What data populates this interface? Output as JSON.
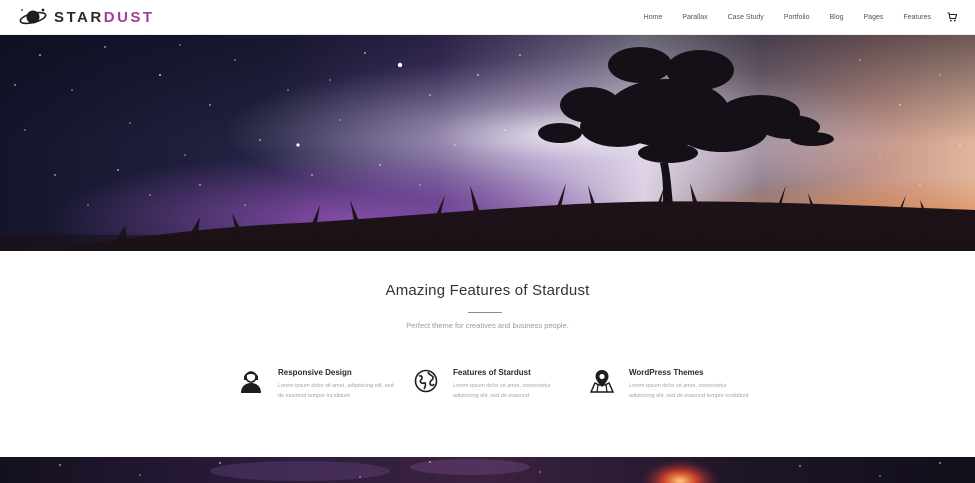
{
  "brand": {
    "name_prefix": "STAR",
    "name_suffix": "DUST",
    "logo_icon": "planet-ring-icon",
    "accent_color": "#a13e96"
  },
  "nav": {
    "items": [
      {
        "label": "Home"
      },
      {
        "label": "Parallax"
      },
      {
        "label": "Case Study"
      },
      {
        "label": "Portfolio"
      },
      {
        "label": "Blog"
      },
      {
        "label": "Pages"
      },
      {
        "label": "Features"
      }
    ],
    "cart_icon": "cart-icon"
  },
  "hero": {
    "image": "starry-night-sky-with-tree-silhouette-and-grass"
  },
  "features_section": {
    "title": "Amazing Features of Stardust",
    "subtitle": "Perfect theme for creatives and business people.",
    "items": [
      {
        "icon": "user-support-icon",
        "title": "Responsive Design",
        "description": "Lorem ipsum dolor sit amet, adipisicing elit, sed do eiusmod tempor incididunt"
      },
      {
        "icon": "globe-icon",
        "title": "Features of Stardust",
        "description": "Lorem ipsum dolor sit amet, consectetur adipisicing elit, sed do eiusmod"
      },
      {
        "icon": "map-pin-icon",
        "title": "WordPress Themes",
        "description": "Lorem ipsum dolor sit amet, consectetur adipisicing elit, sed do eiusmod tempor incididunt"
      }
    ]
  },
  "bottom_strip": {
    "image": "galaxy-nebula-strip"
  }
}
